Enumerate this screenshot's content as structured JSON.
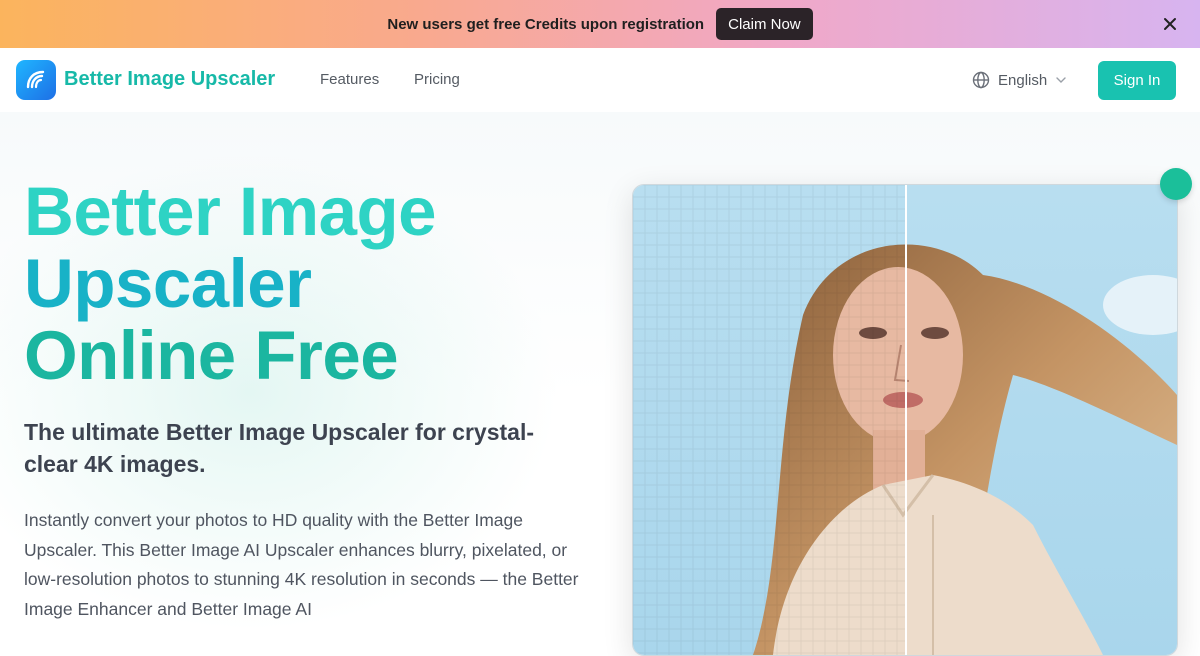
{
  "banner": {
    "text": "New users get free Credits upon registration",
    "cta_label": "Claim Now",
    "close_icon": "close-icon"
  },
  "nav": {
    "brand": "Better Image Upscaler",
    "logo_icon": "wave-logo-icon",
    "links": [
      {
        "label": "Features"
      },
      {
        "label": "Pricing"
      }
    ],
    "language": {
      "label": "English",
      "icon": "globe-icon",
      "chevron": "chevron-down-icon"
    },
    "signin_label": "Sign In"
  },
  "hero": {
    "title_lines": [
      "Better Image",
      "Upscaler",
      "Online Free"
    ],
    "subtitle": "The ultimate Better Image Upscaler for crystal-clear 4K images.",
    "description": "Instantly convert your photos to HD quality with the Better Image Upscaler. This Better Image AI Upscaler enhances blurry, pixelated, or low-resolution photos to stunning 4K resolution in seconds — the Better Image Enhancer and Better Image AI"
  },
  "colors": {
    "accent": "#19c2b0",
    "brand_text": "#17b9a8",
    "title_teal": "#2ed3c4",
    "title_cyan": "#18b2c7",
    "title_green": "#1bb6a0",
    "handle": "#1bbf9a",
    "claim_bg": "#2b2328"
  },
  "compare": {
    "left_state": "pixelated-original",
    "right_state": "enhanced",
    "slider_position": 0.5
  }
}
